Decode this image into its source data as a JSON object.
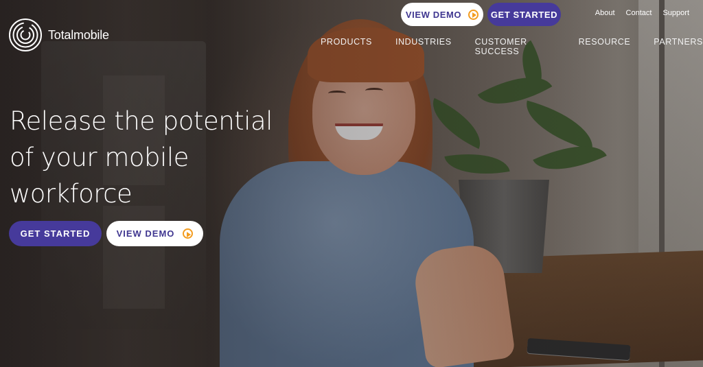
{
  "brand": {
    "name": "Totalmobile"
  },
  "header": {
    "cta_view_demo": "VIEW DEMO",
    "cta_get_started": "GET STARTED",
    "utility_links": [
      "About",
      "Contact",
      "Support"
    ],
    "nav": [
      "PRODUCTS",
      "INDUSTRIES",
      "CUSTOMER SUCCESS",
      "RESOURCE",
      "PARTNERS"
    ]
  },
  "hero": {
    "headline_lines": [
      "Release the potential",
      "of your mobile",
      "workforce"
    ],
    "primary_button": "GET STARTED",
    "secondary_button": "VIEW DEMO"
  },
  "colors": {
    "brand_purple": "#463a9b",
    "accent_orange": "#f39c1f",
    "text_light": "#ffffff"
  },
  "icons": {
    "logo": "concentric-circles-logo-icon",
    "play": "play-circle-icon"
  }
}
